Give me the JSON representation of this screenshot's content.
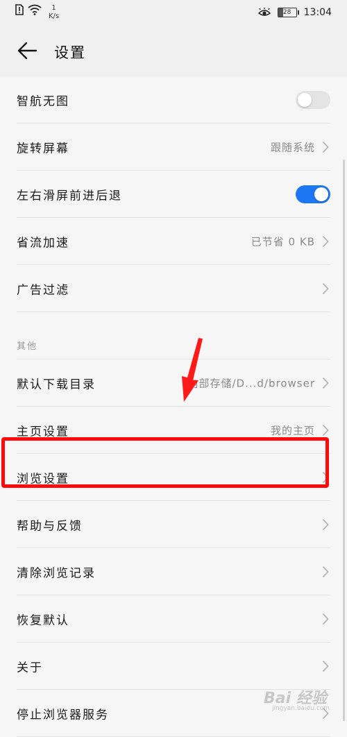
{
  "status_bar": {
    "speed_value": "1",
    "speed_unit": "K/s",
    "battery": "28",
    "time": "13:04"
  },
  "header": {
    "title": "设置"
  },
  "rows": {
    "no_image": {
      "label": "智航无图",
      "toggle": "off"
    },
    "rotate": {
      "label": "旋转屏幕",
      "value": "跟随系统"
    },
    "swipe_nav": {
      "label": "左右滑屏前进后退",
      "toggle": "on"
    },
    "save_data": {
      "label": "省流加速",
      "value": "已节省 0 KB"
    },
    "ad_filter": {
      "label": "广告过滤"
    },
    "section_other": "其他",
    "download_dir": {
      "label": "默认下载目录",
      "value": "内部存储/D...d/browser"
    },
    "homepage": {
      "label": "主页设置",
      "value": "我的主页"
    },
    "browse_settings": {
      "label": "浏览设置"
    },
    "help": {
      "label": "帮助与反馈"
    },
    "clear_history": {
      "label": "清除浏览记录"
    },
    "restore_default": {
      "label": "恢复默认"
    },
    "about": {
      "label": "关于"
    },
    "stop_service": {
      "label": "停止浏览器服务"
    }
  },
  "watermark": {
    "text": "Bai 经验",
    "sub": "jingyan.baidu.com"
  },
  "colors": {
    "accent": "#1e77f2",
    "highlight": "#ff0a0a"
  }
}
